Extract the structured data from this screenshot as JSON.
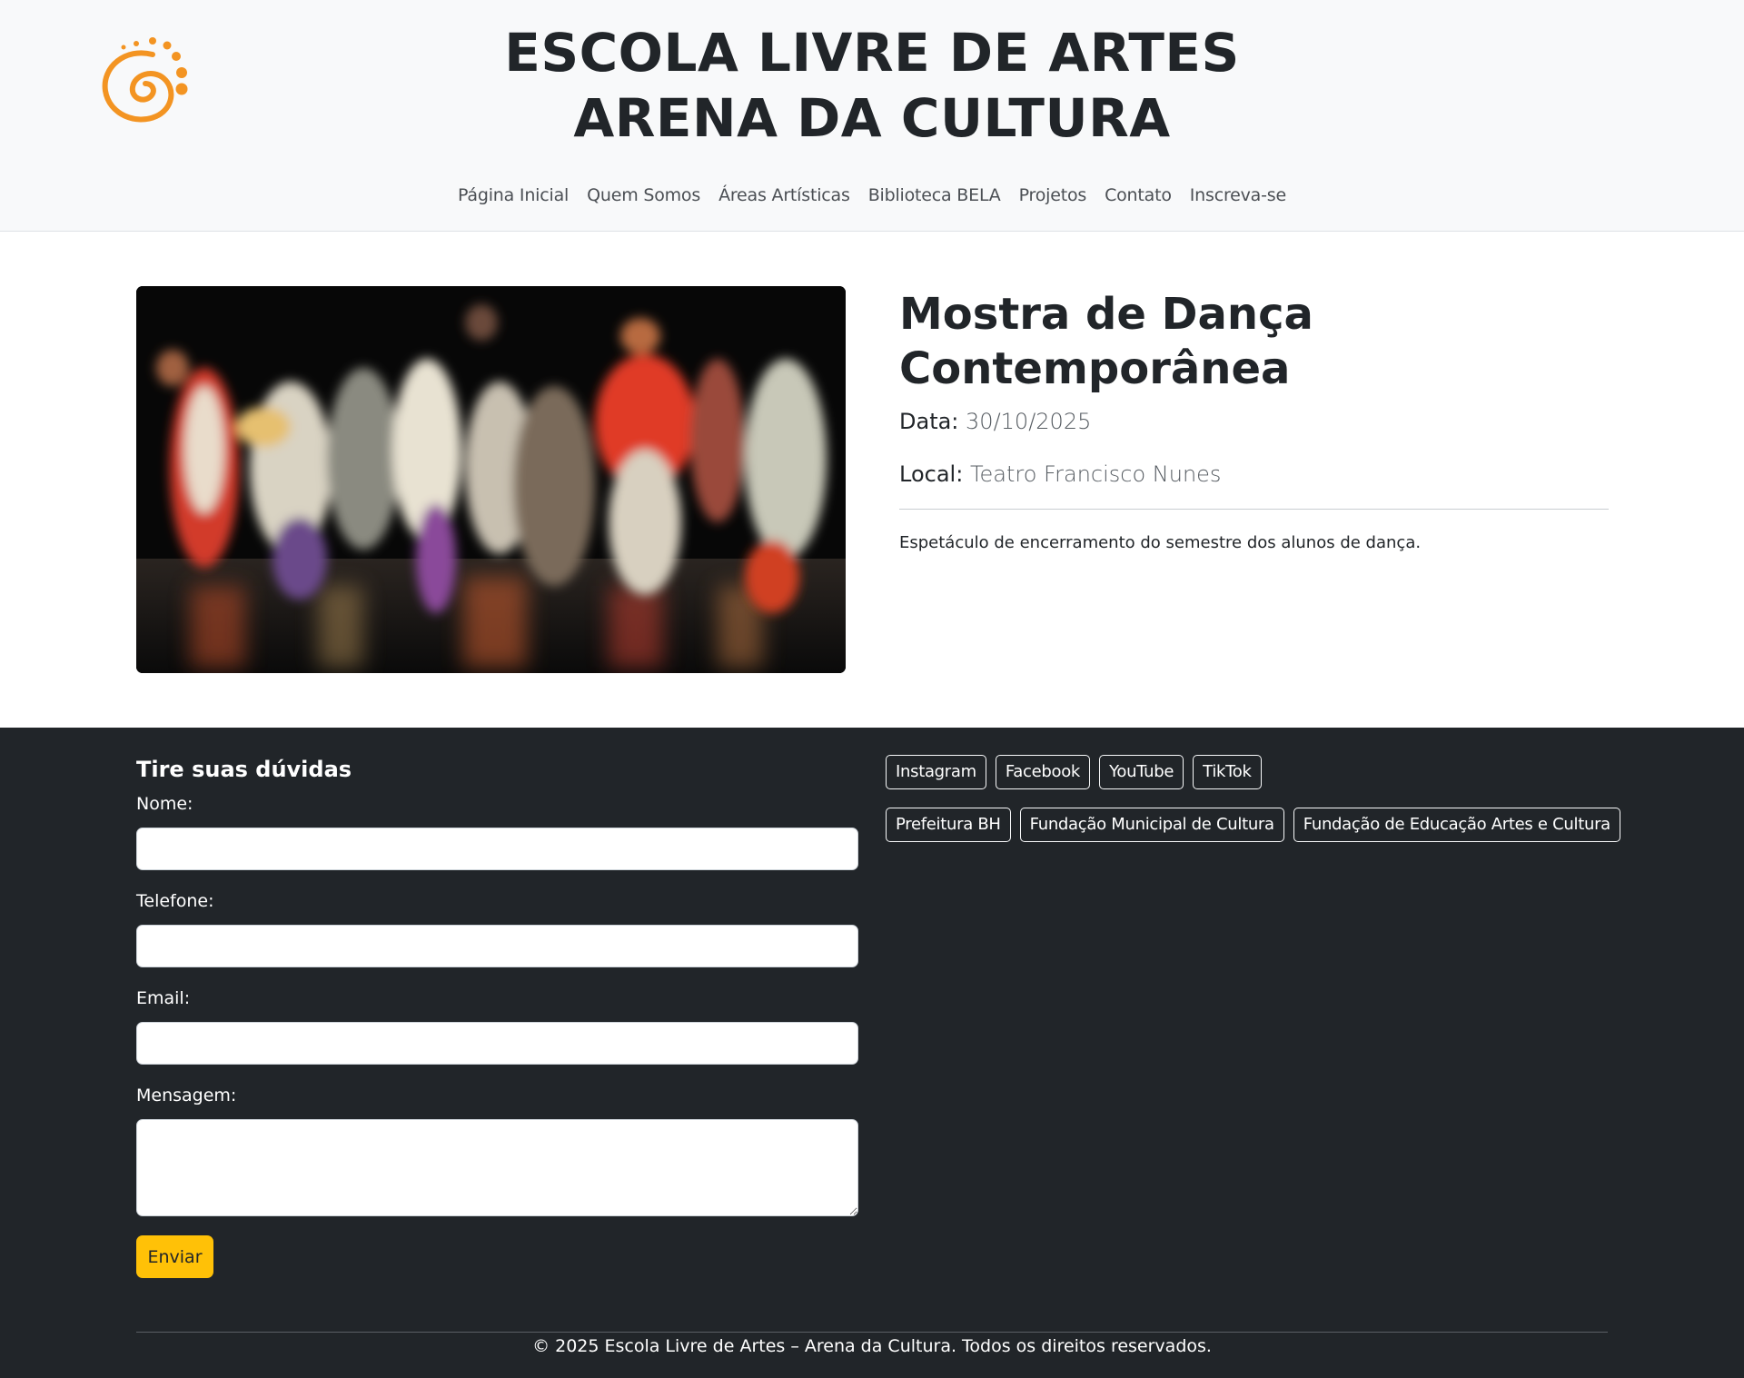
{
  "header": {
    "title_line1": "ESCOLA LIVRE DE ARTES",
    "title_line2": "ARENA DA CULTURA",
    "logo_icon": "orange-spiral-logo-icon",
    "nav": [
      {
        "label": "Página Inicial"
      },
      {
        "label": "Quem Somos"
      },
      {
        "label": "Áreas Artísticas"
      },
      {
        "label": "Biblioteca BELA"
      },
      {
        "label": "Projetos"
      },
      {
        "label": "Contato"
      },
      {
        "label": "Inscreva-se"
      }
    ]
  },
  "event": {
    "title": "Mostra de Dança Contemporânea",
    "date_label": "Data:",
    "date_value": "30/10/2025",
    "local_label": "Local:",
    "local_value": "Teatro Francisco Nunes",
    "description": "Espetáculo de encerramento do semestre dos alunos de dança."
  },
  "contact_form": {
    "title": "Tire suas dúvidas",
    "name_label": "Nome:",
    "phone_label": "Telefone:",
    "email_label": "Email:",
    "message_label": "Mensagem:",
    "submit_label": "Enviar"
  },
  "social_links": [
    {
      "label": "Instagram"
    },
    {
      "label": "Facebook"
    },
    {
      "label": "YouTube"
    },
    {
      "label": "TikTok"
    }
  ],
  "partner_links": [
    {
      "label": "Prefeitura BH"
    },
    {
      "label": "Fundação Municipal de Cultura"
    },
    {
      "label": "Fundação de Educação Artes e Cultura"
    }
  ],
  "footer": {
    "copyright": "© 2025 Escola Livre de Artes – Arena da Cultura. Todos os direitos reservados."
  },
  "colors": {
    "header_bg": "#f8f9fa",
    "footer_bg": "#212529",
    "accent": "#ffc107",
    "logo_orange": "#f39422"
  }
}
